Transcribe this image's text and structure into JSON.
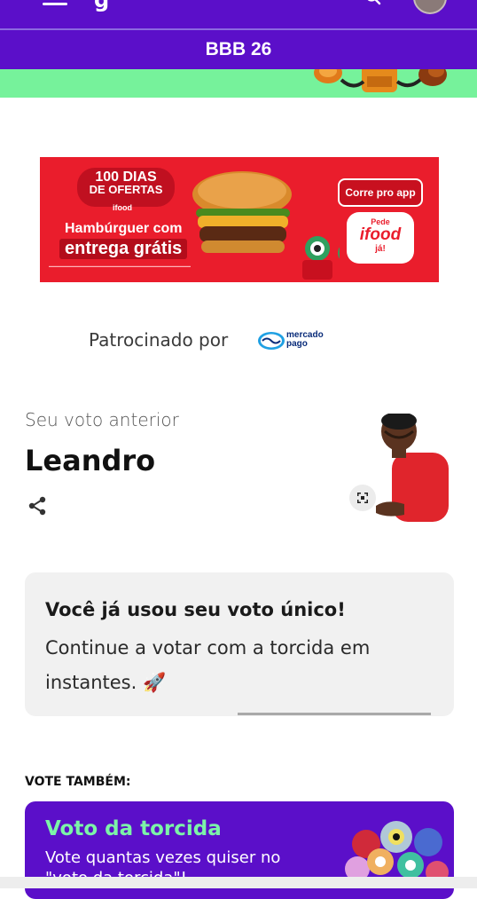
{
  "header": {
    "menu_icon": "hamburger-menu-icon",
    "logo_glyph": "g",
    "search_icon": "search-icon",
    "section_title": "BBB 26",
    "colors": {
      "purple": "#5b0fc9",
      "green": "#76f29b"
    }
  },
  "ad": {
    "badge_line1": "100 DIAS",
    "badge_line2": "DE OFERTAS",
    "brand_small": "ifood",
    "headline1": "Hambúrguer com",
    "headline2": "entrega grátis",
    "cta": "Corre pro app",
    "logo_line1": "Pede",
    "logo_line2": "ifood",
    "logo_line3": "já!",
    "colors": {
      "red": "#ea1d2c"
    }
  },
  "sponsor": {
    "label": "Patrocinado por",
    "brand_line1": "mercado",
    "brand_line2": "pago"
  },
  "previous_vote": {
    "label": "Seu voto anterior",
    "name": "Leandro",
    "share_icon": "share-icon",
    "expand_icon": "expand-icon"
  },
  "notice": {
    "title": "Você já usou seu voto único!",
    "body": "Continue a votar com a torcida em instantes. 🚀"
  },
  "vote_also": {
    "heading": "VOTE TAMBÉM:",
    "card_title": "Voto da torcida",
    "card_desc": "Vote quantas vezes quiser no \"voto da torcida\"!",
    "colors": {
      "title": "#7cf4a8"
    }
  }
}
